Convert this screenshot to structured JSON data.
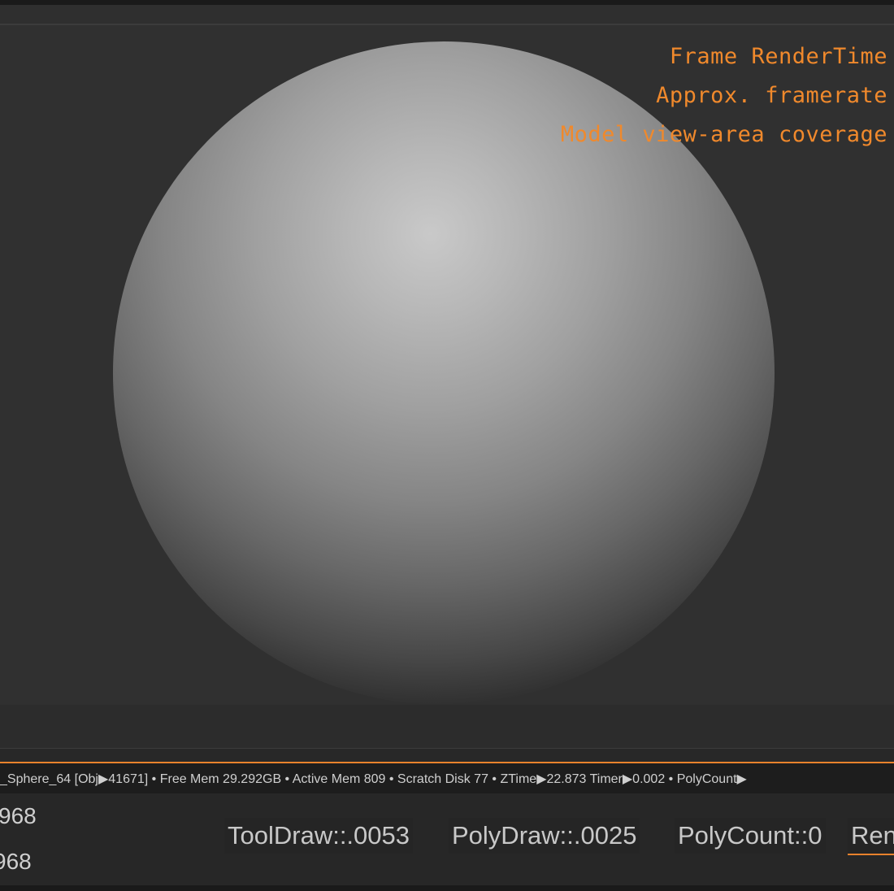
{
  "viewport": {
    "overlay": {
      "line1": "Frame RenderTime",
      "line2": "Approx. framerate",
      "line3": "Model view-area coverage"
    }
  },
  "status_bar": {
    "text": "_Sphere_64  [Obj▶41671]  • Free Mem 29.292GB • Active Mem 809 • Scratch Disk 77 •  ZTime▶22.873 Timer▶0.002 • PolyCount▶"
  },
  "info": {
    "left_values": [
      "968",
      "968"
    ],
    "stats": [
      "ToolDraw::.0053",
      "PolyDraw::.0025",
      "PolyCount::0",
      "Ren"
    ]
  },
  "colors": {
    "overlay_text": "#f0892c",
    "accent": "#e8822c",
    "background": "#303030"
  }
}
